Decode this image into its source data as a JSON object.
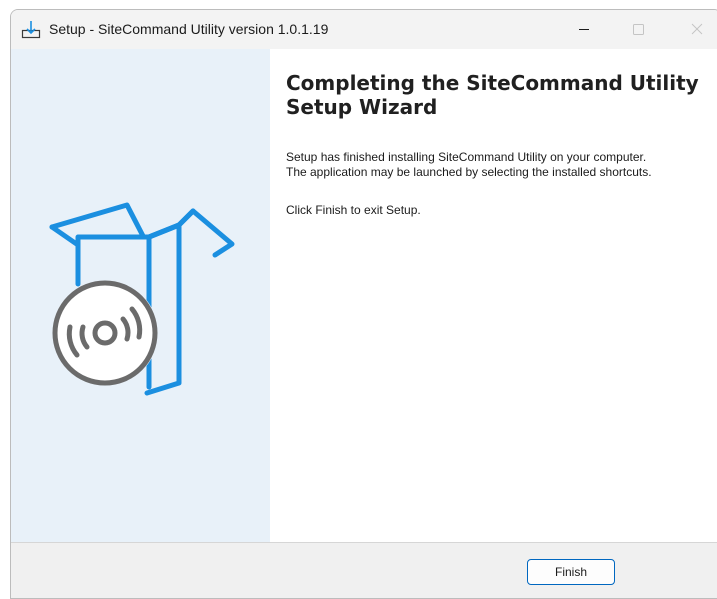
{
  "window": {
    "title": "Setup - SiteCommand Utility version 1.0.1.19",
    "icon": "installer-download-icon"
  },
  "caption_buttons": {
    "minimize_icon": "minimize-icon",
    "maximize_icon": "maximize-icon",
    "close_icon": "close-icon"
  },
  "sidebar": {
    "illustration": "software-box-with-disc-icon"
  },
  "main": {
    "heading": "Completing the SiteCommand Utility Setup Wizard",
    "line1": "Setup has finished installing SiteCommand Utility on your computer.",
    "line2": "The application may be launched by selecting the installed shortcuts.",
    "line3": "Click Finish to exit Setup."
  },
  "footer": {
    "finish_label": "Finish"
  },
  "colors": {
    "accent": "#0067c0",
    "illustration_blue": "#1b8fe0",
    "disc_gray": "#6b6b6b",
    "sidebar_bg": "#e8f1f9"
  }
}
